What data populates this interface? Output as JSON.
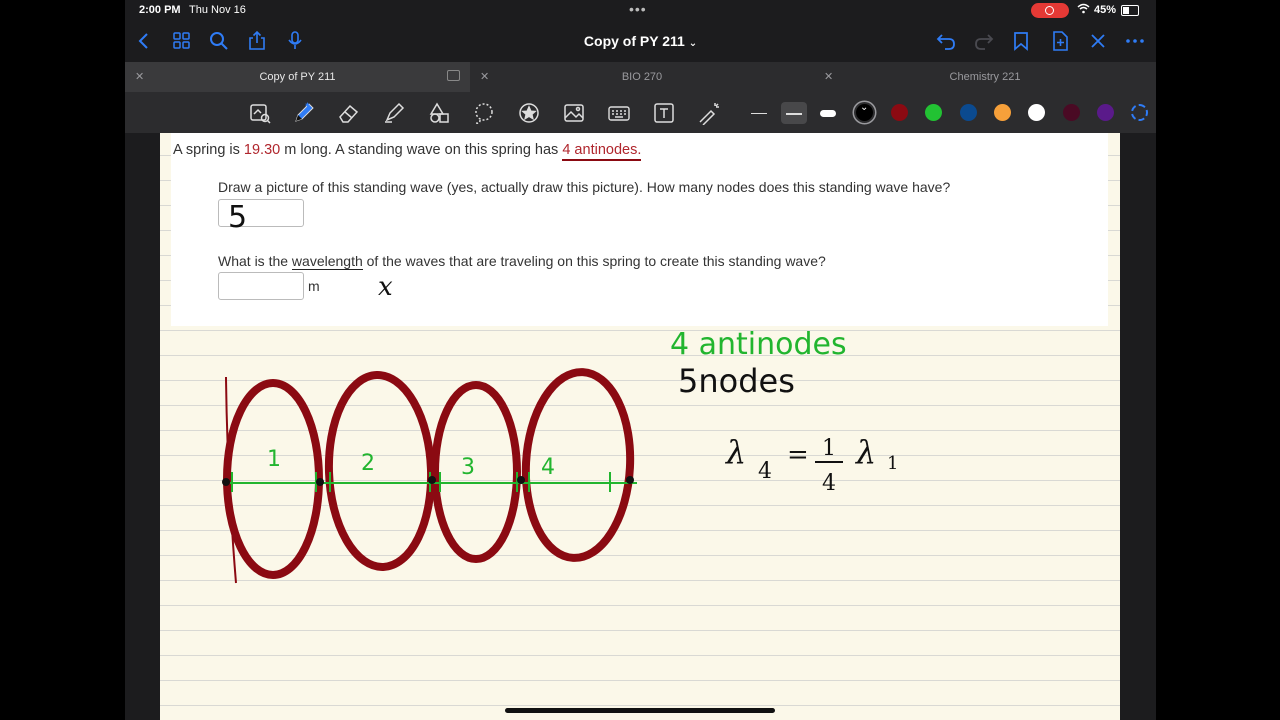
{
  "status": {
    "time": "2:00 PM",
    "date": "Thu Nov 16",
    "battery": "45%"
  },
  "nav": {
    "title": "Copy of PY 211",
    "icons": [
      "back-icon",
      "grid-icon",
      "search-icon",
      "share-icon",
      "microphone-icon",
      "undo-icon",
      "redo-icon",
      "bookmark-icon",
      "add-page-icon",
      "close-icon",
      "more-icon"
    ]
  },
  "tabs": [
    {
      "label": "Copy of PY 211",
      "active": true
    },
    {
      "label": "BIO 270",
      "active": false
    },
    {
      "label": "Chemistry 221",
      "active": false
    }
  ],
  "toolbar": {
    "tools": [
      "read-only-icon",
      "pen-icon",
      "eraser-icon",
      "highlighter-icon",
      "shapes-icon",
      "lasso-icon",
      "sticker-icon",
      "image-icon",
      "keyboard-icon",
      "text-icon",
      "laser-pointer-icon"
    ],
    "colors": [
      "#000000",
      "#8b0a12",
      "#22c233",
      "#0b4a8f",
      "#f6a03a",
      "#ffffff",
      "#4a0a24",
      "#5a1a8a"
    ],
    "selected_color": "#000000",
    "selected_stroke": 1
  },
  "question": {
    "intro_a": "A spring is ",
    "length": "19.30",
    "intro_b": " m long. A standing wave on this spring has ",
    "antinodes": "4 antinodes.",
    "q1": "Draw a picture of this standing wave (yes, actually draw this picture). How many nodes does this standing wave have?",
    "q2_a": "What is the ",
    "q2_word": "wavelength",
    "q2_b": " of the waves that are traveling on this spring to create this standing wave?",
    "q2_unit": "m"
  },
  "handwriting": {
    "answer1": "5",
    "lambda_mark": "x",
    "note1": "4 antinodes",
    "note2": "5nodes",
    "loop_labels": [
      "1",
      "2",
      "3",
      "4"
    ],
    "equation": {
      "lhs": "λ",
      "lhs_sub": "4",
      "eq": "=",
      "num": "1",
      "den": "4",
      "rhs": "λ",
      "rhs_sub": "1"
    }
  }
}
